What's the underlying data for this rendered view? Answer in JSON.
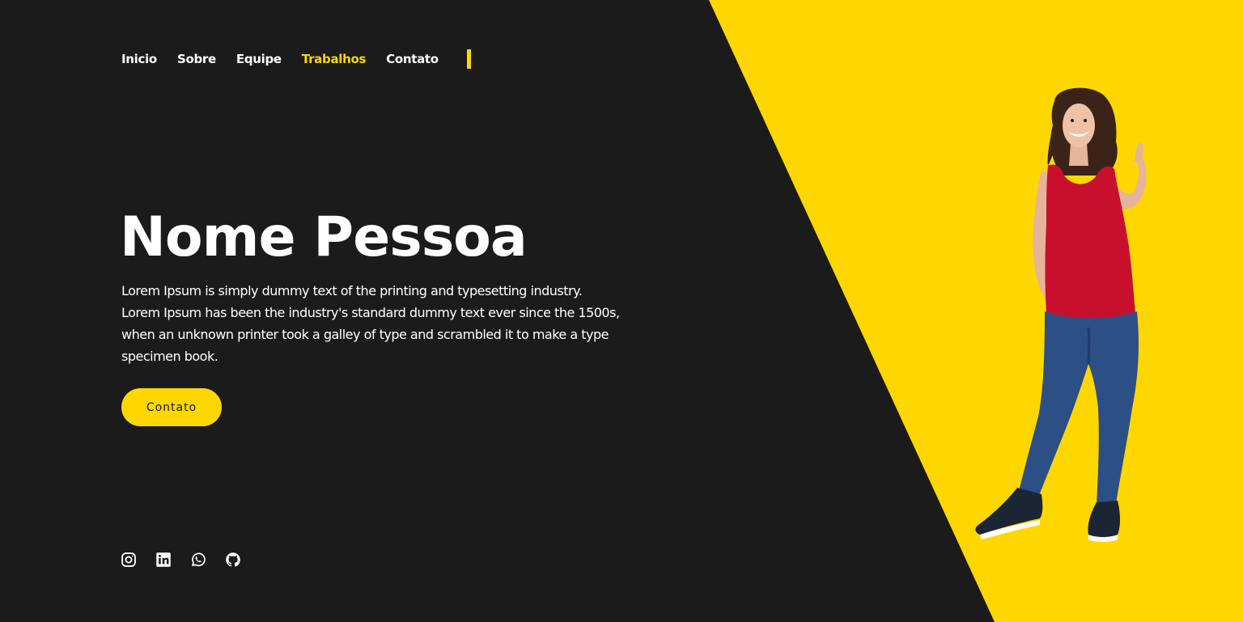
{
  "nav": {
    "items": [
      {
        "label": "Inicio",
        "active": false
      },
      {
        "label": "Sobre",
        "active": false
      },
      {
        "label": "Equipe",
        "active": false
      },
      {
        "label": "Trabalhos",
        "active": true
      },
      {
        "label": "Contato",
        "active": false
      }
    ]
  },
  "hero": {
    "title": "Nome Pessoa",
    "description": "Lorem Ipsum is simply dummy text of the printing and typesetting industry. Lorem Ipsum has been the industry's standard dummy text ever since the 1500s, when an unknown printer took a galley of type and scrambled it to make a type specimen book.",
    "button_label": "Contato"
  },
  "socials": [
    {
      "name": "instagram-icon"
    },
    {
      "name": "linkedin-icon"
    },
    {
      "name": "whatsapp-icon"
    },
    {
      "name": "github-icon"
    }
  ],
  "image": {
    "subject": "woman-thumbs-up-photo"
  },
  "colors": {
    "background": "#1b1b1b",
    "accent": "#fed700",
    "text": "#ffffff"
  }
}
